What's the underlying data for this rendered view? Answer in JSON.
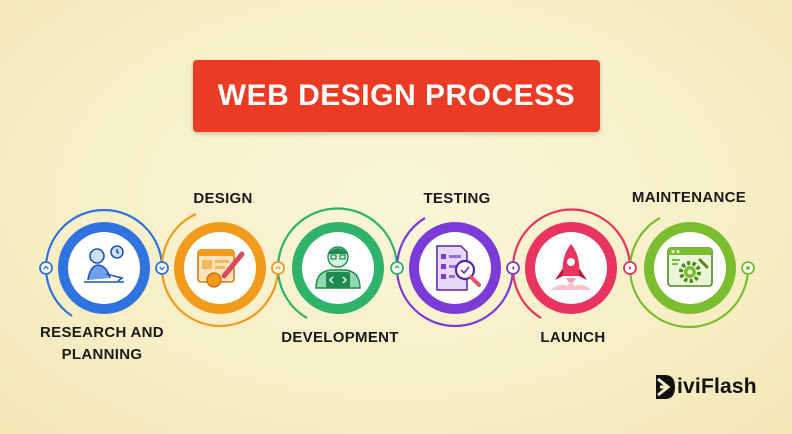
{
  "title": "WEB DESIGN PROCESS",
  "brand": "iviFlash",
  "steps": [
    {
      "label": "RESEARCH AND\nPLANNING",
      "color": "#2e73e0",
      "icon": "researcher-icon"
    },
    {
      "label": "DESIGN",
      "color": "#f29a1c",
      "icon": "design-palette-icon"
    },
    {
      "label": "DEVELOPMENT",
      "color": "#2fb36a",
      "icon": "developer-icon"
    },
    {
      "label": "TESTING",
      "color": "#7a3bd6",
      "icon": "testing-checklist-icon"
    },
    {
      "label": "LAUNCH",
      "color": "#e9345f",
      "icon": "rocket-icon"
    },
    {
      "label": "MAINTENANCE",
      "color": "#7bbd2f",
      "icon": "maintenance-gear-icon"
    }
  ]
}
